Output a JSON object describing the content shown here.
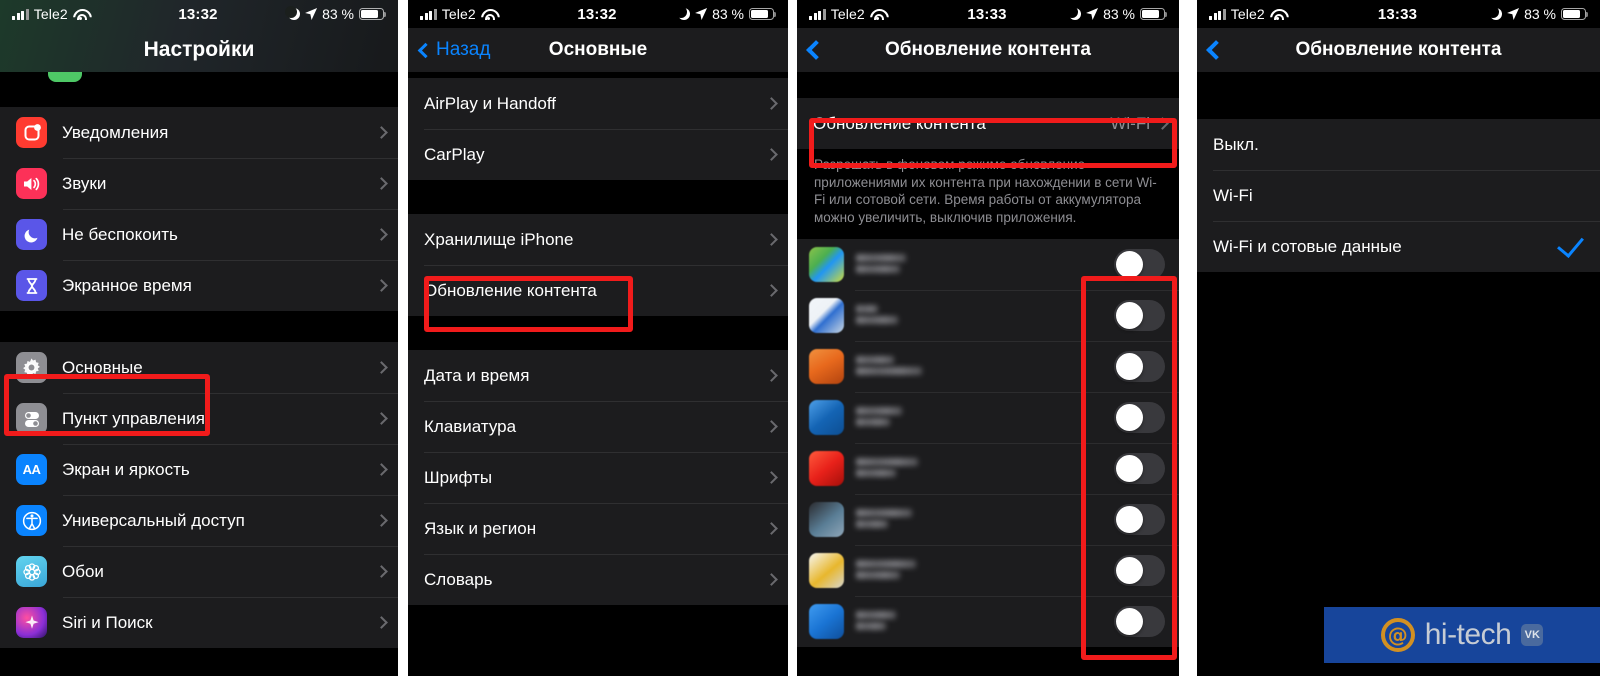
{
  "meta": {
    "watermark": {
      "at": "@",
      "text": "hi-tech",
      "vk": "VK"
    }
  },
  "panels": [
    {
      "id": "settings-root",
      "status": {
        "carrier": "Tele2",
        "time": "13:32",
        "battery_pct": "83 %"
      },
      "nav": {
        "title": "Настройки",
        "back_label": ""
      },
      "groups": [
        {
          "rows": [
            {
              "label": "Уведомления",
              "icon_color": "#ff3b30",
              "icon": "notifications-icon",
              "glyph": ""
            },
            {
              "label": "Звуки",
              "icon_color": "#fc3158",
              "icon": "sounds-icon",
              "glyph": "🔊"
            },
            {
              "label": "Не беспокоить",
              "icon_color": "#5a56e8",
              "icon": "do-not-disturb-icon",
              "glyph": "🌙"
            },
            {
              "label": "Экранное время",
              "icon_color": "#5a56e8",
              "icon": "screen-time-icon",
              "glyph": "⧗"
            }
          ]
        },
        {
          "rows": [
            {
              "label": "Основные",
              "icon_color": "#8e8e93",
              "icon": "general-gear-icon",
              "glyph": "⚙",
              "highlighted": true
            },
            {
              "label": "Пункт управления",
              "icon_color": "#8e8e93",
              "icon": "control-center-icon",
              "glyph": "⦿"
            },
            {
              "label": "Экран и яркость",
              "icon_color": "#0a84ff",
              "icon": "display-brightness-icon",
              "glyph": "AA"
            },
            {
              "label": "Универсальный доступ",
              "icon_color": "#0a84ff",
              "icon": "accessibility-icon",
              "glyph": "♿"
            },
            {
              "label": "Обои",
              "icon_color": "#4cc2e0",
              "icon": "wallpaper-icon",
              "glyph": "✻"
            },
            {
              "label": "Siri и Поиск",
              "icon_color": "#9b3fd1",
              "icon": "siri-icon",
              "glyph": "✦"
            }
          ]
        }
      ]
    },
    {
      "id": "general",
      "status": {
        "carrier": "Tele2",
        "time": "13:32",
        "battery_pct": "83 %"
      },
      "nav": {
        "title": "Основные",
        "back_label": "Назад"
      },
      "groups": [
        {
          "rows": [
            {
              "label": "AirPlay и Handoff"
            },
            {
              "label": "CarPlay"
            }
          ]
        },
        {
          "rows": [
            {
              "label": "Хранилище iPhone"
            },
            {
              "label": "Обновление контента",
              "highlighted": true
            }
          ]
        },
        {
          "rows": [
            {
              "label": "Дата и время"
            },
            {
              "label": "Клавиатура"
            },
            {
              "label": "Шрифты"
            },
            {
              "label": "Язык и регион"
            },
            {
              "label": "Словарь"
            }
          ]
        }
      ]
    },
    {
      "id": "background-refresh",
      "status": {
        "carrier": "Tele2",
        "time": "13:33",
        "battery_pct": "83 %"
      },
      "nav": {
        "title": "Обновление контента",
        "back_label": ""
      },
      "setting_row": {
        "label": "Обновление контента",
        "value": "Wi-Fi"
      },
      "footnote": "Разрешать в фоновом режиме обновление приложениями их контента при нахождении в сети Wi-Fi или сотовой сети. Время работы от аккумулятора можно увеличить, выключив приложения.",
      "apps": [
        {
          "name_redacted": true,
          "icon_colors": [
            "#7ac143",
            "#3ea0dd",
            "#d9c94a"
          ],
          "w1": 50,
          "w2": 44,
          "toggle": "off"
        },
        {
          "name_redacted": true,
          "icon_colors": [
            "#eef2f6",
            "#2f6fd0",
            "#9fb4c9"
          ],
          "w1": 22,
          "w2": 42,
          "toggle": "off"
        },
        {
          "name_redacted": true,
          "icon_colors": [
            "#e8691d",
            "#b2430f",
            "#f0913f"
          ],
          "w1": 38,
          "w2": 66,
          "toggle": "off"
        },
        {
          "name_redacted": true,
          "icon_colors": [
            "#1464b4",
            "#4d9fe8",
            "#0d4e92"
          ],
          "w1": 46,
          "w2": 34,
          "toggle": "off"
        },
        {
          "name_redacted": true,
          "icon_colors": [
            "#e8211a",
            "#ff5a3c",
            "#a50f0a"
          ],
          "w1": 62,
          "w2": 40,
          "toggle": "off"
        },
        {
          "name_redacted": true,
          "icon_colors": [
            "#2b2b2f",
            "#5a7e96",
            "#8fa6b8"
          ],
          "w1": 56,
          "w2": 32,
          "toggle": "off"
        },
        {
          "name_redacted": true,
          "icon_colors": [
            "#f1f1ee",
            "#e8b72d",
            "#c9c9c4"
          ],
          "w1": 60,
          "w2": 44,
          "toggle": "off"
        },
        {
          "name_redacted": true,
          "icon_colors": [
            "#1a74d4",
            "#3f9bf0",
            "#0f4f9b"
          ],
          "w1": 40,
          "w2": 30,
          "toggle": "off"
        }
      ]
    },
    {
      "id": "refresh-options",
      "status": {
        "carrier": "Tele2",
        "time": "13:33",
        "battery_pct": "83 %"
      },
      "nav": {
        "title": "Обновление контента",
        "back_label": ""
      },
      "options": [
        {
          "label": "Выкл.",
          "selected": false
        },
        {
          "label": "Wi-Fi",
          "selected": false
        },
        {
          "label": "Wi-Fi и сотовые данные",
          "selected": true
        }
      ]
    }
  ]
}
